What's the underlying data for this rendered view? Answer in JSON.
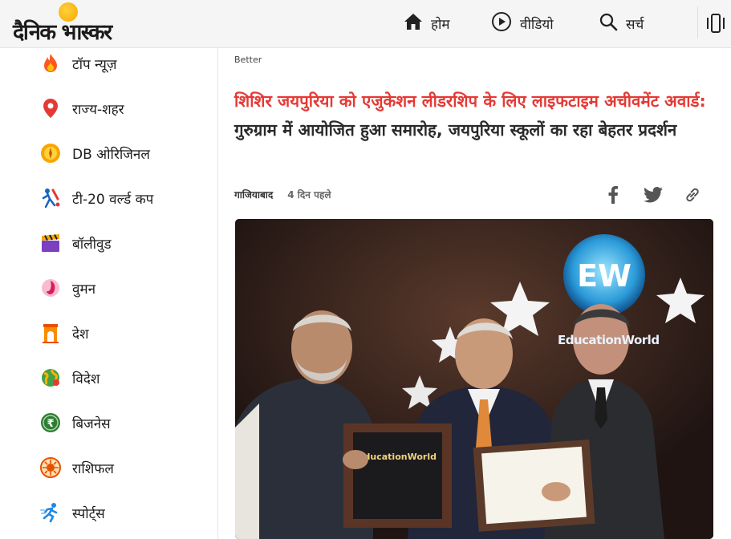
{
  "header": {
    "logo_text": "दैनिक भास्कर",
    "nav": [
      {
        "label": "होम",
        "icon": "home-icon"
      },
      {
        "label": "वीडियो",
        "icon": "play-icon"
      },
      {
        "label": "सर्च",
        "icon": "search-icon"
      }
    ],
    "more_icon": "device-menu-icon"
  },
  "sidebar": {
    "items": [
      {
        "label": "टॉप न्यूज़",
        "icon": "flame-icon",
        "color": "#ff5722"
      },
      {
        "label": "राज्य-शहर",
        "icon": "location-pin-icon",
        "color": "#e53935"
      },
      {
        "label": "DB ओरिजिनल",
        "icon": "db-original-icon",
        "color": "#f7a600"
      },
      {
        "label": "टी-20 वर्ल्ड कप",
        "icon": "cricket-icon",
        "color": "#1565c0"
      },
      {
        "label": "बॉलीवुड",
        "icon": "clapperboard-icon",
        "color": "#7b3fbf"
      },
      {
        "label": "वुमन",
        "icon": "woman-icon",
        "color": "#d81b60"
      },
      {
        "label": "देश",
        "icon": "india-gate-icon",
        "color": "#e65100"
      },
      {
        "label": "विदेश",
        "icon": "globe-icon",
        "color": "#43a047"
      },
      {
        "label": "बिजनेस",
        "icon": "rupee-icon",
        "color": "#2e7d32"
      },
      {
        "label": "राशिफल",
        "icon": "zodiac-icon",
        "color": "#e65100"
      },
      {
        "label": "स्पोर्ट्स",
        "icon": "runner-icon",
        "color": "#1e88e5"
      }
    ]
  },
  "article": {
    "category": "Better",
    "headline_highlight": "शिशिर जयपुरिया को एजुकेशन लीडरशिप के लिए लाइफटाइम अचीवमेंट अवार्ड:",
    "headline_rest": " गुरुग्राम में आयोजित हुआ समारोह, जयपुरिया स्कूलों का रहा बेहतर प्रदर्शन",
    "location": "गाजियाबाद",
    "time": "4 दिन पहले",
    "share": [
      "facebook-icon",
      "twitter-icon",
      "link-icon"
    ],
    "photo_text": "EducationWorld",
    "photo_badge": "EW"
  }
}
